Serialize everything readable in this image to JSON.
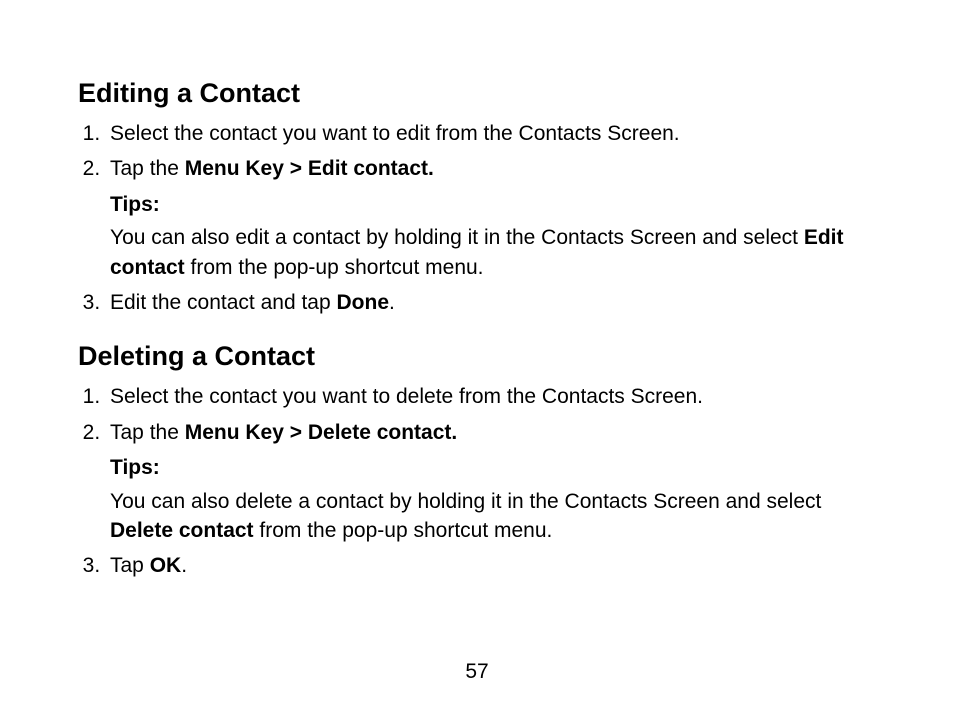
{
  "section1": {
    "heading": "Editing a Contact",
    "step1": "Select the contact you want to edit from the Contacts Screen.",
    "step2_pre": "Tap the ",
    "step2_bold": "Menu Key > Edit contact.",
    "tips_label": "Tips:",
    "tips_pre": "You can also edit a contact by holding it in the Contacts Screen and select ",
    "tips_bold": "Edit contact",
    "tips_post": " from the pop-up shortcut menu.",
    "step3_pre": "Edit the contact and tap ",
    "step3_bold": "Done",
    "step3_post": "."
  },
  "section2": {
    "heading": "Deleting a Contact",
    "step1": "Select the contact you want to delete from the Contacts Screen.",
    "step2_pre": "Tap the ",
    "step2_bold": "Menu Key > Delete contact.",
    "tips_label": "Tips:",
    "tips_pre": "You can also delete a contact by holding it in the Contacts Screen and select ",
    "tips_bold": "Delete contact",
    "tips_post": " from the pop-up shortcut menu.",
    "step3_pre": "Tap ",
    "step3_bold": "OK",
    "step3_post": "."
  },
  "page_number": "57"
}
